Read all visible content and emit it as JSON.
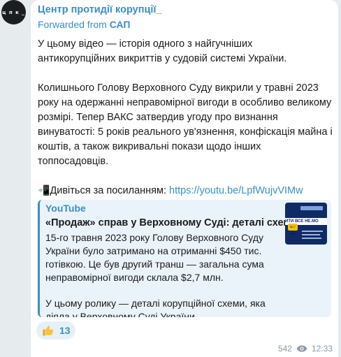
{
  "channel": {
    "avatar_text": "ц п к _",
    "name": "Центр протидії корупції_",
    "forwarded_prefix": "Forwarded from",
    "forwarded_from": "САП"
  },
  "message": {
    "paragraph_1": "У цьому відео — історія одного з найгучніших антикорупційних викриттів у судовій системі України.",
    "paragraph_2": "Колишнього Голову Верховного Суду викрили у травні 2023 року на одержанні неправомірної вигоди в особливо великому розмірі. Тепер ВАКС затвердив угоду про визнання винуватості: 5 років реального ув'язнення, конфіскація майна і коштів, а також викривальні покази щодо інших топпосадовців.",
    "link_emoji": "📲",
    "link_label": "Дивіться за посиланням:",
    "link_url": "https://youtu.be/LpfWujvVIMw"
  },
  "link_preview": {
    "site": "YouTube",
    "title": "«Продаж» справ у Верховному Суді: деталі схеми",
    "description_1": "15-го травня 2023 року Голову Верховного Суду України було затримано на отриманні $450 тис. готівкою. Це був другий транш — загальна сума неправомірної вигоди склала $2,7 млн.",
    "description_2": "У цьому ролику — деталі корупційної схеми, яка діяла у Верховному Суді України.…",
    "thumbnail_text": "ИТИ ВСЕ НЕ.МО",
    "thumbnail_badge": "$2,7 млн"
  },
  "reaction": {
    "emoji": "thumbs-up-icon",
    "count": "13"
  },
  "footer": {
    "views": "542",
    "time": "12:33"
  },
  "colors": {
    "accent": "#3a8fc4",
    "background": "#e6ebee",
    "bubble": "#ffffff",
    "preview_bg": "#eaf3fa"
  }
}
